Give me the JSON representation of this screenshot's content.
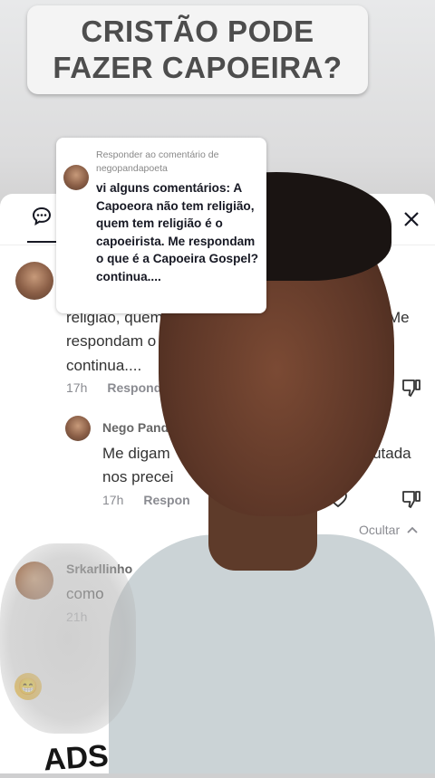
{
  "video": {
    "banner_line1": "CRISTÃO PODE",
    "banner_line2": "FAZER CAPOEIRA?",
    "shirt_print": "ADS"
  },
  "reply_to": {
    "label": "Responder ao comentário de",
    "username": "negopandapoeta",
    "text": "vi alguns comentários: A Capoeora não tem religião, quem tem religião é o capoeirista. Me respondam o que é a Capoeira Gospel? continua...."
  },
  "comments": [
    {
      "text_line1": "religião, quem",
      "text_line1_end": "Me",
      "text_line2": "respondam o",
      "text_line3": "continua....",
      "time": "17h",
      "reply_label": "Respond"
    },
    {
      "username": "Nego Pand",
      "text_line1": "Me digam",
      "text_line1_end": "a pautada",
      "text_line2": "nos precei",
      "time": "17h",
      "reply_label": "Respon"
    },
    {
      "username": "Srkarllinho",
      "text_line1": "como",
      "time": "21h"
    }
  ],
  "hide_replies": "Ocultar",
  "icons": {
    "comments_tab": "comment-bubble-icon",
    "filter": "sliders-icon",
    "close": "close-icon",
    "like": "heart-icon",
    "dislike": "thumbs-down-icon",
    "chevron": "chevron-up-icon",
    "emoji": "grinning-emoji-icon"
  }
}
